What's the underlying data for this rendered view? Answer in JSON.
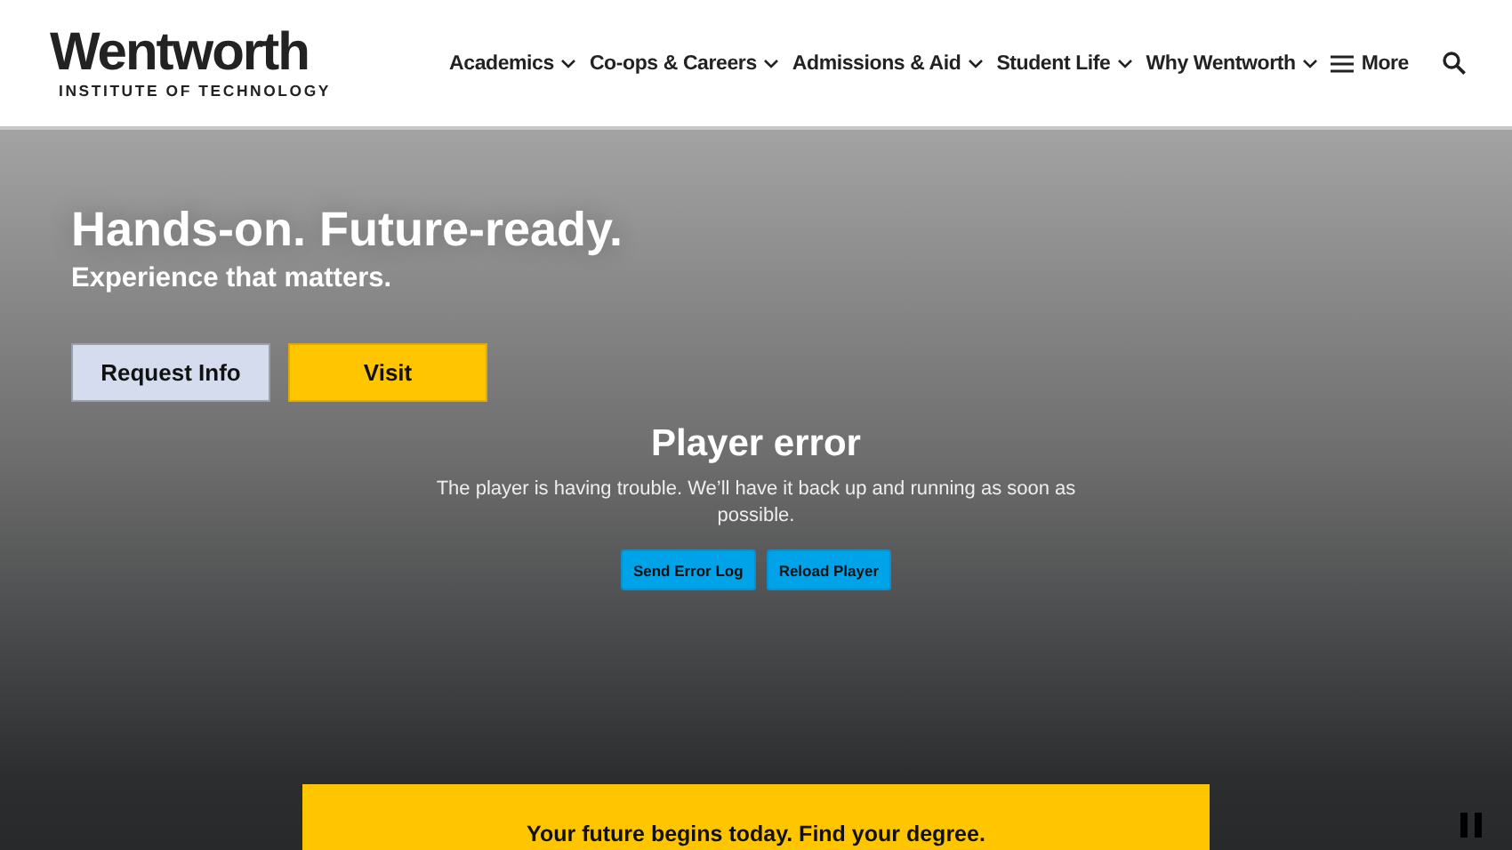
{
  "header": {
    "logo": {
      "name": "Wentworth",
      "tagline": "INSTITUTE OF TECHNOLOGY"
    },
    "nav": [
      {
        "label": "Academics",
        "kind": "dropdown"
      },
      {
        "label": "Co-ops & Careers",
        "kind": "dropdown"
      },
      {
        "label": "Admissions & Aid",
        "kind": "dropdown"
      },
      {
        "label": "Student Life",
        "kind": "dropdown"
      },
      {
        "label": "Why Wentworth",
        "kind": "dropdown"
      },
      {
        "label": "More",
        "kind": "menu"
      }
    ]
  },
  "hero": {
    "title": "Hands-on. Future-ready.",
    "subtitle": "Experience that matters.",
    "buttons": [
      {
        "label": "Request Info",
        "kind": "secondary"
      },
      {
        "label": "Visit",
        "kind": "primary"
      }
    ],
    "player_error": {
      "title": "Player error",
      "message": "The player is having trouble. We’ll have it back up and running as soon as possible.",
      "buttons": [
        "Send Error Log",
        "Reload Player"
      ]
    },
    "degree_banner": "Your future begins today. Find your degree."
  }
}
